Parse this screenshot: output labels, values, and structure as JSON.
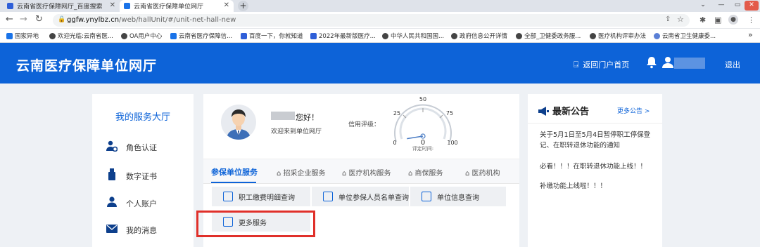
{
  "browser": {
    "tabs": [
      {
        "title": "云南省医疗保障网厅_百度搜索",
        "active": false
      },
      {
        "title": "云南省医疗保障单位网厅",
        "active": true
      }
    ],
    "url": {
      "host": "ggfw.ynylbz.cn",
      "path": "/web/hallUnit/#/unit-net-hall-new"
    },
    "bookmarks": [
      "国家异地",
      "欢迎光临:云南省医...",
      "OA用户中心",
      "云南省医疗保障信...",
      "百度一下，你就知道",
      "2022年最新版医疗...",
      "中华人民共和国国...",
      "政府信息公开详情",
      "全部_卫健委政务服...",
      "医疗机构评审办法",
      "云南省卫生健康委..."
    ],
    "more_bookmarks": "»"
  },
  "header": {
    "site_title": "云南医疗保障单位网厅",
    "portal_link": "返回门户首页",
    "logout": "退出"
  },
  "sidebar": {
    "title": "我的服务大厅",
    "items": [
      {
        "label": "角色认证",
        "icon": "user-gear-icon"
      },
      {
        "label": "数字证书",
        "icon": "usb-key-icon"
      },
      {
        "label": "个人账户",
        "icon": "person-icon"
      },
      {
        "label": "我的消息",
        "icon": "envelope-icon"
      }
    ]
  },
  "profile": {
    "greeting": "您好！",
    "welcome": "欢迎来到单位网厅",
    "credit_label": "信用评级：",
    "gauge": {
      "max_label": "50",
      "left_label": "25",
      "right_label": "75",
      "min_label": "0",
      "end_label": "100",
      "value": "0",
      "caption": "评定时间:",
      "level": 0
    }
  },
  "service_tabs": [
    {
      "label": "参保单位服务",
      "active": true
    },
    {
      "label": "招采企业服务",
      "active": false
    },
    {
      "label": "医疗机构服务",
      "active": false
    },
    {
      "label": "商保服务",
      "active": false
    },
    {
      "label": "医药机构",
      "active": false
    }
  ],
  "service_buttons": [
    {
      "label": "职工缴费明细查询",
      "icon": "document-icon"
    },
    {
      "label": "单位参保人员名单查询",
      "icon": "search-document-icon"
    },
    {
      "label": "单位信息查询",
      "icon": "id-card-icon"
    },
    {
      "label": "更多服务",
      "icon": "building-icon"
    }
  ],
  "notices": {
    "title": "最新公告",
    "more": "更多公告 >",
    "items": [
      "关于5月1日至5月4日暂停职工停保登记、在职转退休功能的通知",
      "必看！！！在职转退休功能上线！！",
      "补缴功能上线啦！！！"
    ]
  },
  "colors": {
    "brand_blue": "#0d63d8",
    "highlight_red": "#e0302a"
  }
}
